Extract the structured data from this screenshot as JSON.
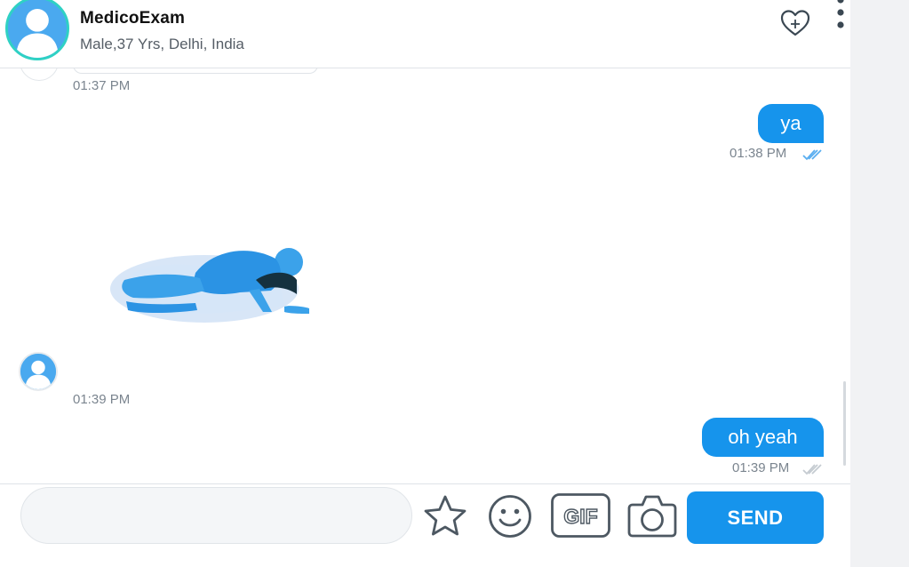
{
  "header": {
    "name": "MedicoExam",
    "info": "Male,37 Yrs, Delhi, India"
  },
  "messages": [
    {
      "direction": "in",
      "time": "01:37 PM"
    },
    {
      "direction": "out",
      "text": "ya",
      "time": "01:38 PM",
      "status": "read"
    },
    {
      "direction": "in",
      "type": "sticker",
      "time": "01:39 PM"
    },
    {
      "direction": "out",
      "text": "oh yeah",
      "time": "01:39 PM",
      "status": "delivered"
    }
  ],
  "composer": {
    "placeholder": "",
    "gif_label": "GIF",
    "send_label": "SEND"
  },
  "colors": {
    "accent": "#1694ec",
    "read_ticks": "#5aaef0",
    "unread_ticks": "#c5cbd1"
  },
  "icons": [
    "user-avatar-icon",
    "heart-plus-icon",
    "more-vertical-icon",
    "double-check-icon",
    "star-icon",
    "smiley-icon",
    "gif-icon",
    "camera-icon"
  ]
}
